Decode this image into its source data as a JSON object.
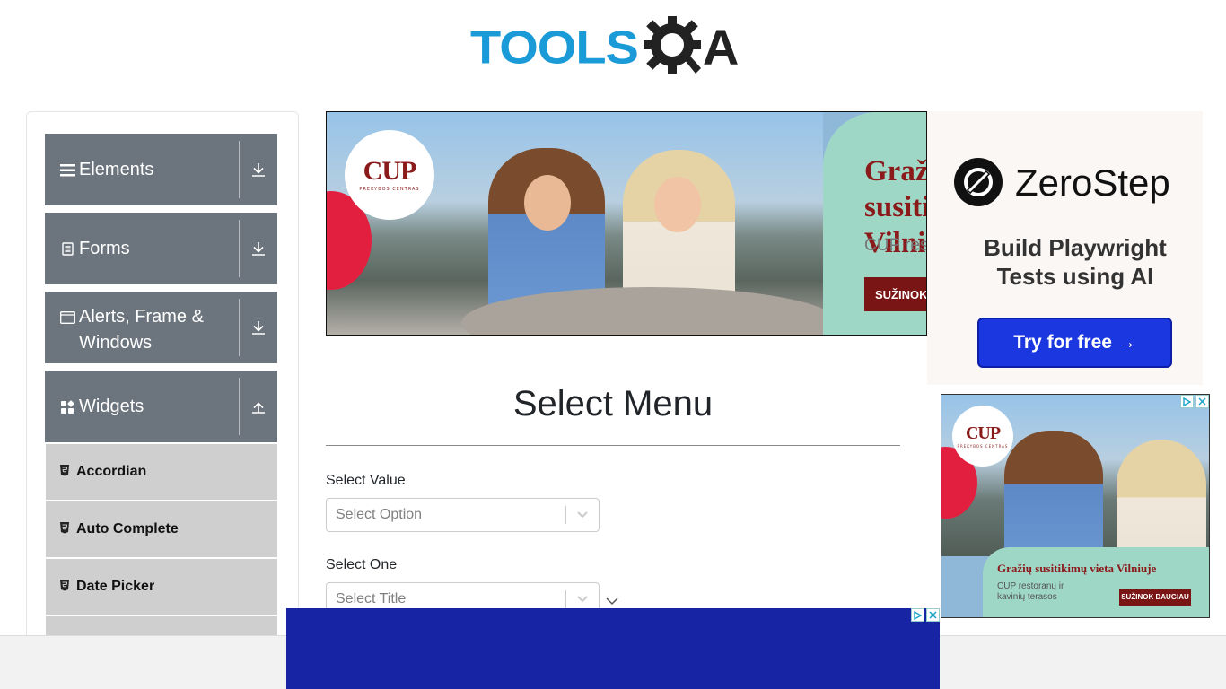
{
  "header": {
    "logo_text": "TOOLS",
    "logo_suffix": "A"
  },
  "sidebar": {
    "groups": [
      {
        "label": "Elements",
        "icon": "hamburger-icon",
        "expanded": false
      },
      {
        "label": "Forms",
        "icon": "document-icon",
        "expanded": false
      },
      {
        "label": "Alerts, Frame & Windows",
        "icon": "window-icon",
        "expanded": false
      },
      {
        "label": "Widgets",
        "icon": "widgets-icon",
        "expanded": true
      }
    ],
    "widget_items": [
      {
        "label": "Accordian"
      },
      {
        "label": "Auto Complete"
      },
      {
        "label": "Date Picker"
      }
    ]
  },
  "banner_ad": {
    "logo": "CUP",
    "logo_sub": "PREKYBOS CENTRAS",
    "headline": "Gražių susitikimų vieta Vilniuje",
    "subtext": "CUP restoranų ir kavinių terasos",
    "cta": "SUŽINOK DAUGIAU"
  },
  "main": {
    "title": "Select Menu",
    "select_value": {
      "label": "Select Value",
      "placeholder": "Select Option"
    },
    "select_one": {
      "label": "Select One",
      "placeholder": "Select Title"
    }
  },
  "right_ad_top": {
    "brand": "ZeroStep",
    "tagline": "Build Playwright Tests using AI",
    "cta": "Try for free →"
  },
  "right_ad_bottom": {
    "logo": "CUP",
    "logo_sub": "PREKYBOS CENTRAS",
    "headline": "Gražių susitikimų vieta Vilniuje",
    "subtext": "CUP restoranų ir kavinių terasos",
    "cta": "SUŽINOK DAUGIAU"
  },
  "colors": {
    "brand_blue": "#1a9bd7",
    "sidebar_group": "#6c757d",
    "sidebar_item": "#cfcfcf",
    "bottom_ad": "#1724a3"
  }
}
